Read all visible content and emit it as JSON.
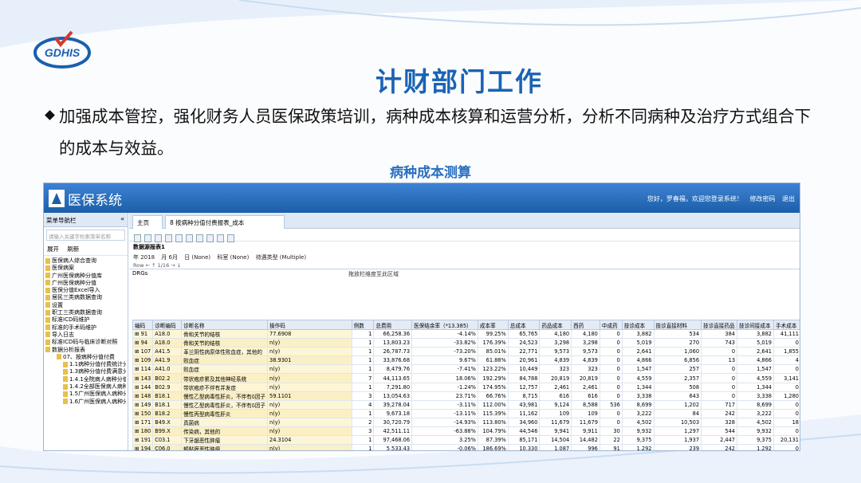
{
  "slide": {
    "title": "计财部门工作",
    "bullet": "加强成本管控，强化财务人员医保政策培训，病种成本核算和运营分析，分析不同病种及治疗方式组合下的成本与效益。",
    "subtitle": "病种成本测算",
    "logo_text": "GDHIS"
  },
  "app": {
    "title": "医保系统",
    "user_text": "您好，罗春福，欢迎您登录系统！",
    "change_password": "修改密码",
    "quit": "退出"
  },
  "sidebar": {
    "header": "菜单导航栏",
    "collapse": "«",
    "search_placeholder": "请输入关键字检索菜单名称",
    "expand_label": "展开",
    "refresh_label": "刷新",
    "items": [
      {
        "label": "医保病人综合查询",
        "depth": 1
      },
      {
        "label": "医保病案",
        "depth": 1
      },
      {
        "label": "广州医保病种分值库",
        "depth": 1
      },
      {
        "label": "广州医保病种分值",
        "depth": 1
      },
      {
        "label": "医保分值Excel导入",
        "depth": 1
      },
      {
        "label": "居民三类病数据查询",
        "depth": 1
      },
      {
        "label": "设置",
        "depth": 1
      },
      {
        "label": "职工三类病数据查询",
        "depth": 1
      },
      {
        "label": "标准ICD码维护",
        "depth": 1
      },
      {
        "label": "标准的手术码维护",
        "depth": 1
      },
      {
        "label": "导入日志",
        "depth": 1
      },
      {
        "label": "标准ICD码与临床诊断对照",
        "depth": 1
      },
      {
        "label": "数据分析报表",
        "depth": 1
      },
      {
        "label": "07、按病种分值付费",
        "depth": 2
      },
      {
        "label": "1.1病种分值付费统计分析",
        "depth": 3
      },
      {
        "label": "1.3病种分值付费满意分析",
        "depth": 3
      },
      {
        "label": "1.4.1全院病人病种分值",
        "depth": 3
      },
      {
        "label": "1.4.2全部医保病人病种分",
        "depth": 3
      },
      {
        "label": "1.5广州医保病人病种分值",
        "depth": 3
      },
      {
        "label": "1.6广州医保病人病种分",
        "depth": 3
      }
    ]
  },
  "tabs": {
    "home": "主页",
    "report": "8 按病种分值付费报表_成本"
  },
  "filters": {
    "title": "数据源报表1",
    "year": "年 2018",
    "month": "月 6月",
    "day": "日 (None)",
    "dept": "科室 (None)",
    "pay_type": "待遇类型 (Multiple)",
    "row_info": "Row ← ↑ 1/16 → ↓"
  },
  "dims": {
    "drg": "DRGs",
    "hint": "拖放栏维度至此区域"
  },
  "table": {
    "columns": [
      "编码",
      "诊断编码",
      "诊断名称",
      "操作码",
      "例数",
      "总费用",
      "医保结余率（*13.385）",
      "成本率",
      "总成本",
      "药品成本",
      "西药",
      "中成药",
      "技诊成本",
      "技诊直接材料",
      "技诊直接药品",
      "技诊间接成本",
      "手术成本"
    ],
    "rows": [
      [
        "91",
        "A18.0",
        "骨和关节的结核",
        "77.6908",
        "1",
        "66,258.36",
        "-4.14%",
        "99.25%",
        "65,765",
        "4,180",
        "4,180",
        "0",
        "3,882",
        "534",
        "384",
        "3,882",
        "41,111"
      ],
      [
        "94",
        "A18.0",
        "骨和关节的结核",
        "n(y)",
        "1",
        "13,803.23",
        "-33.82%",
        "176.39%",
        "24,523",
        "3,298",
        "3,298",
        "0",
        "5,019",
        "270",
        "743",
        "5,019",
        "0"
      ],
      [
        "107",
        "A41.5",
        "革兰阴性病原体性败血症，其他的",
        "n(y)",
        "1",
        "26,787.73",
        "-73.20%",
        "85.01%",
        "22,771",
        "9,573",
        "9,573",
        "0",
        "2,641",
        "1,060",
        "0",
        "2,641",
        "1,855"
      ],
      [
        "109",
        "A41.9",
        "败血症",
        "38.9301",
        "1",
        "33,876.68",
        "9.67%",
        "61.88%",
        "20,961",
        "4,839",
        "4,839",
        "0",
        "4,866",
        "6,856",
        "13",
        "4,866",
        "4"
      ],
      [
        "114",
        "A41.0",
        "败血症",
        "n(y)",
        "1",
        "8,479.76",
        "-7.41%",
        "123.22%",
        "10,449",
        "323",
        "323",
        "0",
        "1,547",
        "257",
        "0",
        "1,547",
        "0"
      ],
      [
        "143",
        "B02.2",
        "带状疱疹累及其他神经系统",
        "n(y)",
        "7",
        "44,113.65",
        "18.06%",
        "192.29%",
        "84,788",
        "20,819",
        "20,819",
        "0",
        "4,559",
        "2,357",
        "0",
        "4,559",
        "3,141"
      ],
      [
        "144",
        "B02.9",
        "带状疱疹不伴有并发症",
        "n(y)",
        "1",
        "7,291.80",
        "-1.24%",
        "174.95%",
        "12,757",
        "2,461",
        "2,461",
        "0",
        "1,344",
        "508",
        "0",
        "1,344",
        "0"
      ],
      [
        "148",
        "B18.1",
        "慢性乙型病毒性肝炎，不伴有δ因子",
        "59.1101",
        "3",
        "13,054.63",
        "23.71%",
        "66.76%",
        "8,715",
        "616",
        "616",
        "0",
        "3,338",
        "643",
        "0",
        "3,338",
        "1,280"
      ],
      [
        "149",
        "B18.1",
        "慢性乙型病毒性肝炎，不伴有δ因子",
        "n(y)",
        "4",
        "39,278.04",
        "-3.11%",
        "112.00%",
        "43,981",
        "9,124",
        "8,588",
        "536",
        "8,699",
        "1,202",
        "717",
        "8,699",
        "0"
      ],
      [
        "150",
        "B18.2",
        "慢性丙型病毒性肝炎",
        "n(y)",
        "1",
        "9,673.18",
        "-13.11%",
        "115.39%",
        "11,162",
        "109",
        "109",
        "0",
        "3,222",
        "84",
        "242",
        "3,222",
        "0"
      ],
      [
        "171",
        "B49.X",
        "真菌病",
        "n(y)",
        "2",
        "30,720.79",
        "-14.93%",
        "113.80%",
        "34,960",
        "11,679",
        "11,679",
        "0",
        "4,502",
        "10,503",
        "328",
        "4,502",
        "18"
      ],
      [
        "180",
        "B99.X",
        "传染病，其他的",
        "n(y)",
        "3",
        "42,511.11",
        "-63.88%",
        "104.79%",
        "44,546",
        "9,941",
        "9,911",
        "30",
        "9,932",
        "1,297",
        "544",
        "9,932",
        "0"
      ],
      [
        "191",
        "C03.1",
        "下牙龈恶性肿瘤",
        "24.3104",
        "1",
        "97,468.06",
        "3.25%",
        "87.39%",
        "85,171",
        "14,504",
        "14,482",
        "22",
        "9,375",
        "1,937",
        "2,447",
        "9,375",
        "20,131"
      ],
      [
        "194",
        "C06.0",
        "颊黏膜恶性肿瘤",
        "n(y)",
        "1",
        "5,533.43",
        "-0.06%",
        "186.69%",
        "10,330",
        "1,087",
        "996",
        "91",
        "1,292",
        "239",
        "242",
        "1,292",
        "0"
      ]
    ]
  },
  "colors": {
    "title": "#1a63b4",
    "header_bar": "#2b6fc2",
    "row_highlight": "#fdf6d6"
  }
}
